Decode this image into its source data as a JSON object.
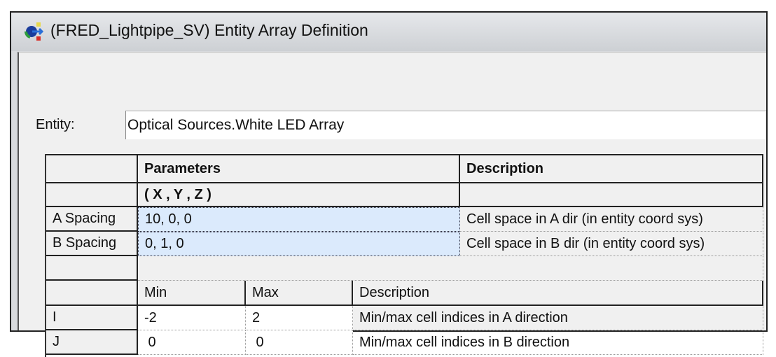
{
  "window": {
    "title": "(FRED_Lightpipe_SV) Entity Array Definition",
    "icon": "fred-app-icon"
  },
  "entity": {
    "label": "Entity:",
    "value": "Optical Sources.White LED Array"
  },
  "spacing_table": {
    "headers": {
      "parameters": "Parameters",
      "description": "Description",
      "subheader": "( X , Y , Z )"
    },
    "rows": [
      {
        "label": "A Spacing",
        "value": "10,  0,  0",
        "description": "Cell space in A dir (in entity coord sys)"
      },
      {
        "label": "B Spacing",
        "value": "0,  1,  0",
        "description": "Cell space in B dir (in entity coord sys)"
      }
    ]
  },
  "index_table": {
    "headers": {
      "min": "Min",
      "max": "Max",
      "description": "Description"
    },
    "rows": [
      {
        "label": "I",
        "min": "-2",
        "max": "2",
        "description": "Min/max cell indices in A direction"
      },
      {
        "label": "J",
        "min": " 0",
        "max": " 0",
        "description": "Min/max cell indices in B direction"
      }
    ]
  }
}
